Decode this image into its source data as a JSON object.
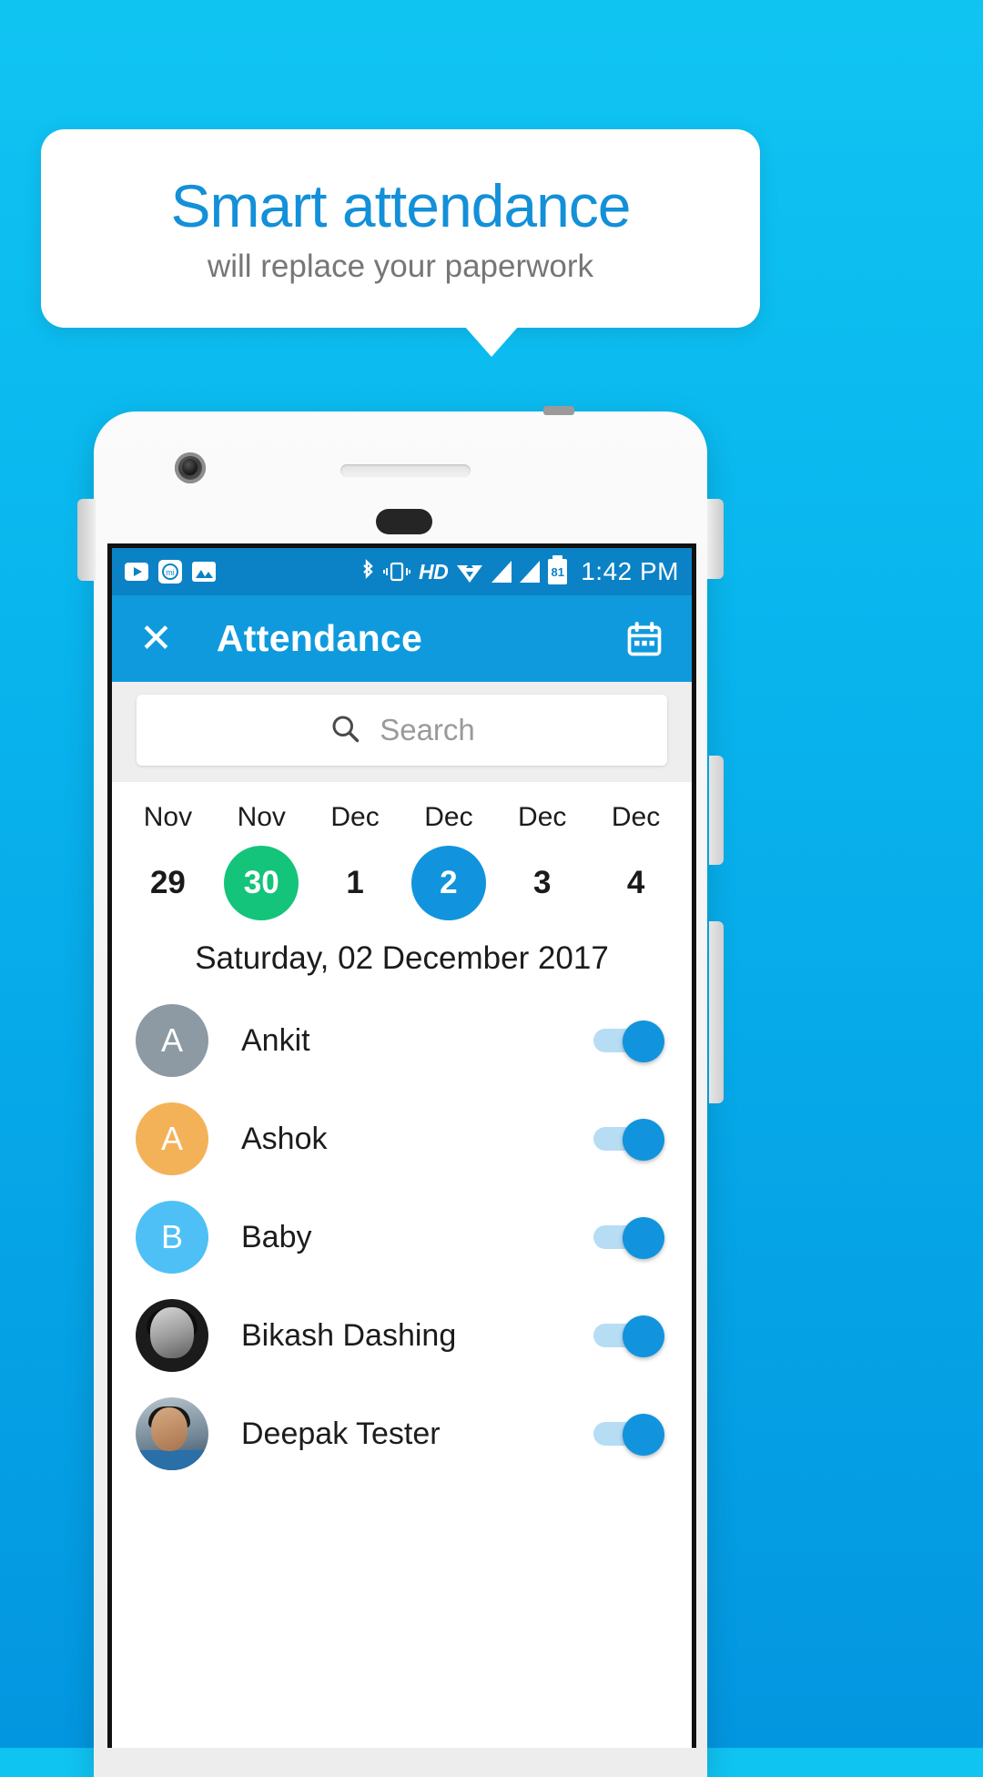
{
  "promo": {
    "title": "Smart attendance",
    "subtitle": "will replace your paperwork",
    "title_color": "#1390d8",
    "subtitle_color": "#767676",
    "background_color": "#0ab9ef"
  },
  "status_bar": {
    "time": "1:42 PM",
    "battery_level": "81",
    "hd_label": "HD",
    "left_icons": [
      "youtube-icon",
      "mi-camera-icon",
      "gallery-icon"
    ],
    "right_icons": [
      "bluetooth-icon",
      "vibrate-icon",
      "hd-icon",
      "wifi-icon",
      "signal-1-icon",
      "signal-2-icon",
      "battery-icon"
    ],
    "background_color": "#0b82c6"
  },
  "app_bar": {
    "close_label": "✕",
    "title": "Attendance",
    "calendar_icon": "calendar-icon",
    "background_color": "#0f9ade"
  },
  "search": {
    "placeholder": "Search",
    "value": "",
    "icon": "search-icon"
  },
  "date_strip": [
    {
      "month": "Nov",
      "day": "29",
      "state": "normal"
    },
    {
      "month": "Nov",
      "day": "30",
      "state": "today"
    },
    {
      "month": "Dec",
      "day": "1",
      "state": "normal"
    },
    {
      "month": "Dec",
      "day": "2",
      "state": "selected"
    },
    {
      "month": "Dec",
      "day": "3",
      "state": "normal"
    },
    {
      "month": "Dec",
      "day": "4",
      "state": "normal"
    }
  ],
  "selected_date_label": "Saturday, 02 December 2017",
  "people": [
    {
      "name": "Ankit",
      "avatar_type": "initial",
      "initial": "A",
      "avatar_color": "#8d9aa3",
      "present": true
    },
    {
      "name": "Ashok",
      "avatar_type": "initial",
      "initial": "A",
      "avatar_color": "#f4b258",
      "present": true
    },
    {
      "name": "Baby",
      "avatar_type": "initial",
      "initial": "B",
      "avatar_color": "#4fc0f5",
      "present": true
    },
    {
      "name": "Bikash Dashing",
      "avatar_type": "photo",
      "initial": "",
      "avatar_color": "#1b1b1b",
      "present": true
    },
    {
      "name": "Deepak Tester",
      "avatar_type": "photo",
      "initial": "",
      "avatar_color": "#6f8494",
      "present": true
    }
  ],
  "colors": {
    "accent_blue": "#1194dd",
    "today_green": "#14c47a",
    "toggle_track": "#b7ddf5"
  }
}
